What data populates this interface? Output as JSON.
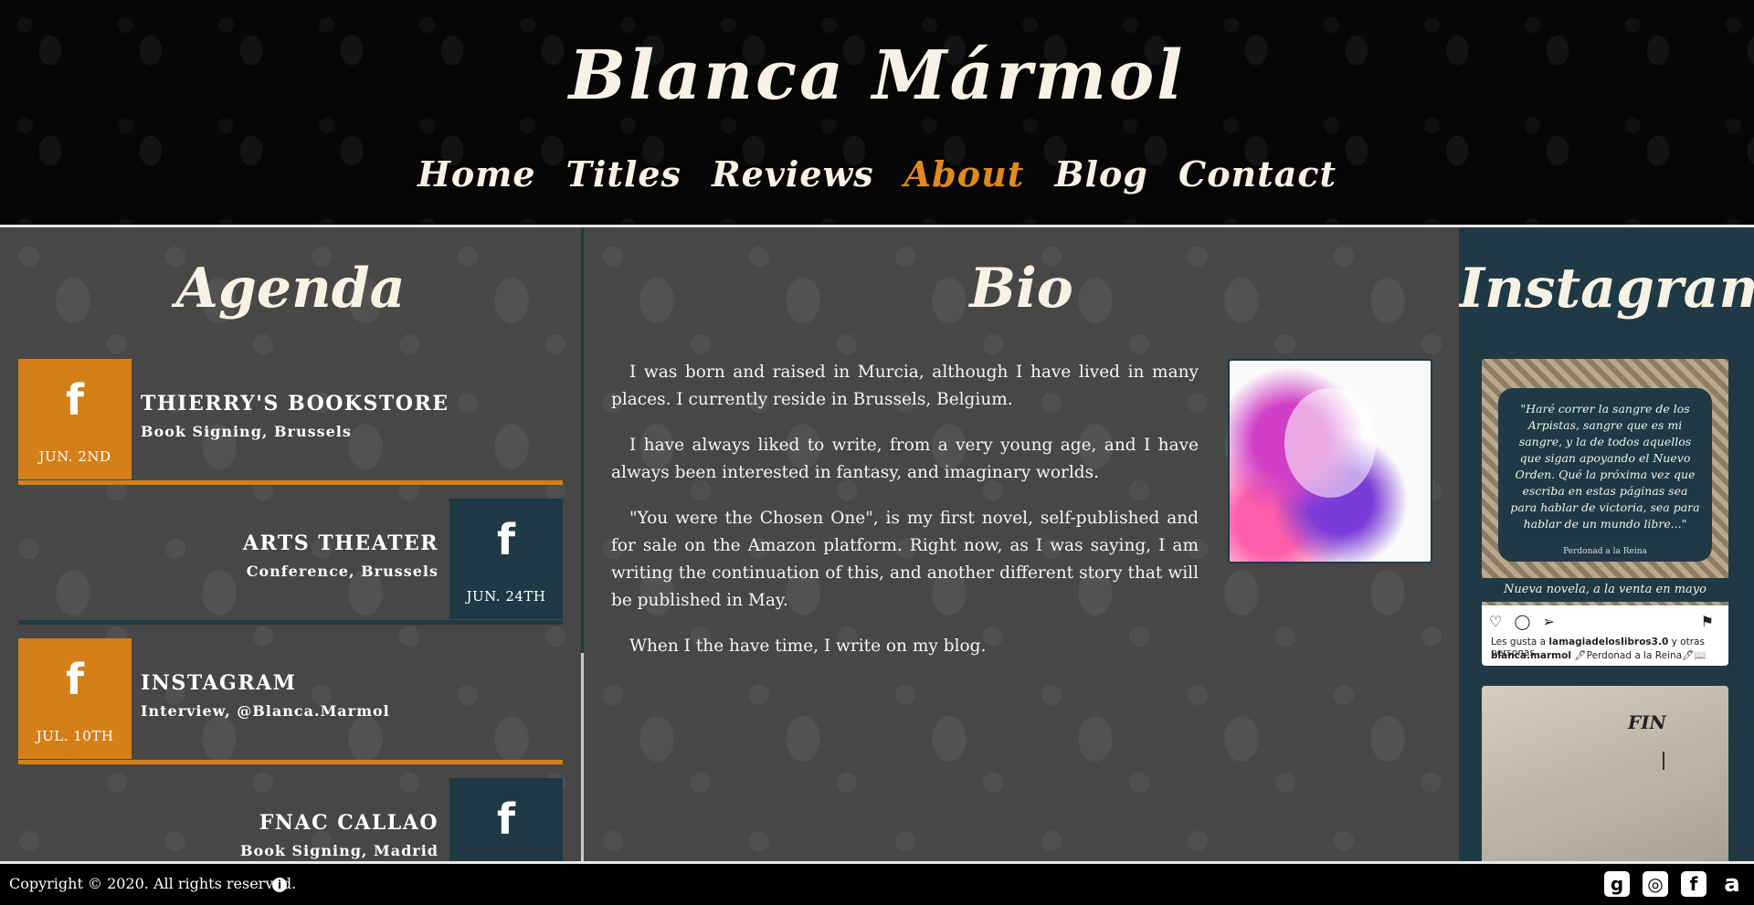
{
  "site": {
    "title": "Blanca Mármol"
  },
  "nav": {
    "items": [
      {
        "label": "Home"
      },
      {
        "label": "Titles"
      },
      {
        "label": "Reviews"
      },
      {
        "label": "About",
        "active": true
      },
      {
        "label": "Blog"
      },
      {
        "label": "Contact"
      }
    ]
  },
  "agenda": {
    "title": "Agenda",
    "events": [
      {
        "name": "THIERRY'S BOOKSTORE",
        "detail": "Book Signing, Brussels",
        "date": "JUN. 2ND",
        "icon": "facebook-icon"
      },
      {
        "name": "ARTS THEATER",
        "detail": "Conference, Brussels",
        "date": "JUN. 24TH",
        "icon": "facebook-icon"
      },
      {
        "name": "INSTAGRAM",
        "detail": "Interview, @Blanca.Marmol",
        "date": "JUL. 10TH",
        "icon": "facebook-icon"
      },
      {
        "name": "FNAC CALLAO",
        "detail": "Book Signing, Madrid",
        "date": "",
        "icon": "facebook-icon"
      }
    ]
  },
  "bio": {
    "title": "Bio",
    "paragraphs": [
      "I was born and raised in Murcia, although I have lived in many places. I currently reside in Brussels, Belgium.",
      "I have always liked to write, from a very young age, and I have always been interested in fantasy, and imaginary worlds.",
      "\"You were the Chosen One\", is my first novel, self-published and for sale on the Amazon platform. Right now, as I was saying, I am writing the continuation of this, and another different story that will be published in May.",
      "When I the have time, I write on my blog."
    ]
  },
  "instagram": {
    "title": "Instagram",
    "post1": {
      "quote": "\"Haré correr la sangre de los Arpistas, sangre que es mi sangre, y la de todos aquellos que sigan apoyando el Nuevo Orden. Qué la próxima vez que escriba en estas páginas sea para hablar de victoria, sea para hablar de un mundo libre...\"",
      "quote_caption": "Perdonad a la Reina",
      "banner": "Nueva novela, a la venta en mayo",
      "likes_prefix": "Les gusta a ",
      "likes_user": "lamagiadelosIibros3.0",
      "likes_suffix": " y otras personas",
      "caption_user": "blanca.marmol",
      "caption_text": " 🖊Perdonad a la Reina🖊📖"
    },
    "post2": {
      "text": "FIN"
    }
  },
  "footer": {
    "copyright": "Copyright © 2020. All rights reserved.",
    "info": "i",
    "social": [
      {
        "name": "goodreads-icon",
        "glyph": "g"
      },
      {
        "name": "instagram-icon",
        "glyph": "◎"
      },
      {
        "name": "facebook-icon",
        "glyph": "f"
      },
      {
        "name": "amazon-icon",
        "glyph": "a"
      }
    ]
  },
  "colors": {
    "accent": "#e08a1e",
    "orange_box": "#d47f18",
    "teal": "#1f3a44",
    "panel": "#474747"
  }
}
